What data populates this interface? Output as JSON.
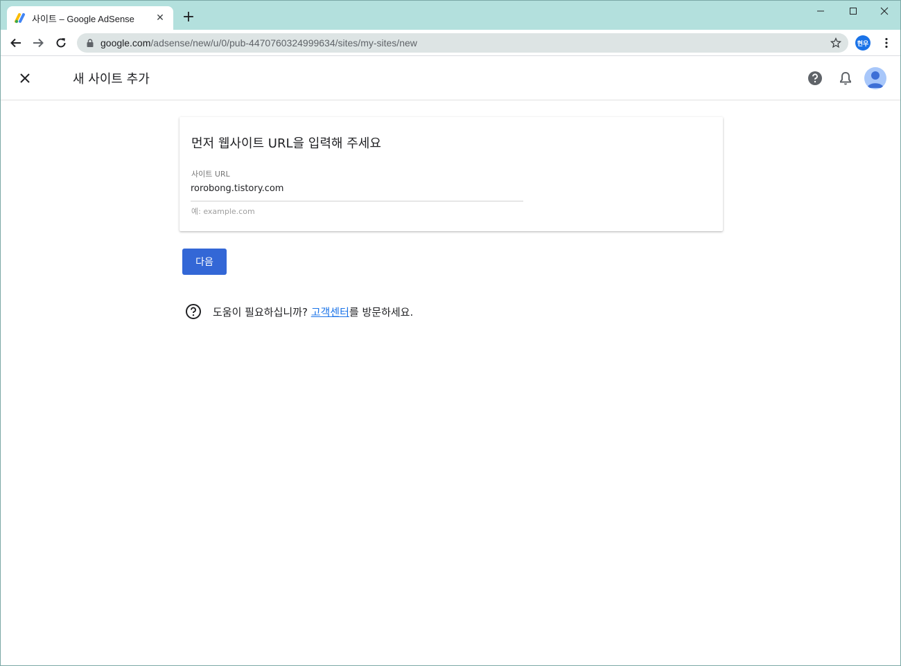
{
  "browser": {
    "tab_title": "사이트 – Google AdSense",
    "url_host": "google.com",
    "url_path": "/adsense/new/u/0/pub-4470760324999634/sites/my-sites/new",
    "profile_label": "현우"
  },
  "header": {
    "title": "새 사이트 추가"
  },
  "card": {
    "title": "먼저 웹사이트 URL을 입력해 주세요",
    "field_label": "사이트 URL",
    "field_value": "rorobong.tistory.com",
    "field_hint": "예: example.com"
  },
  "actions": {
    "next_label": "다음"
  },
  "help": {
    "prefix": "도움이 필요하십니까? ",
    "link": "고객센터",
    "suffix": "를 방문하세요."
  },
  "colors": {
    "titlebar": "#b3e0dd",
    "primary_button": "#3367d6",
    "link": "#1a73e8"
  },
  "icons": [
    "adsense-favicon",
    "close-tab-icon",
    "new-tab-icon",
    "minimize-icon",
    "maximize-icon",
    "window-close-icon",
    "back-icon",
    "forward-icon",
    "reload-icon",
    "lock-icon",
    "bookmark-star-icon",
    "menu-kebab-icon",
    "close-icon",
    "help-icon",
    "notifications-bell-icon",
    "account-avatar",
    "question-circle-icon"
  ]
}
